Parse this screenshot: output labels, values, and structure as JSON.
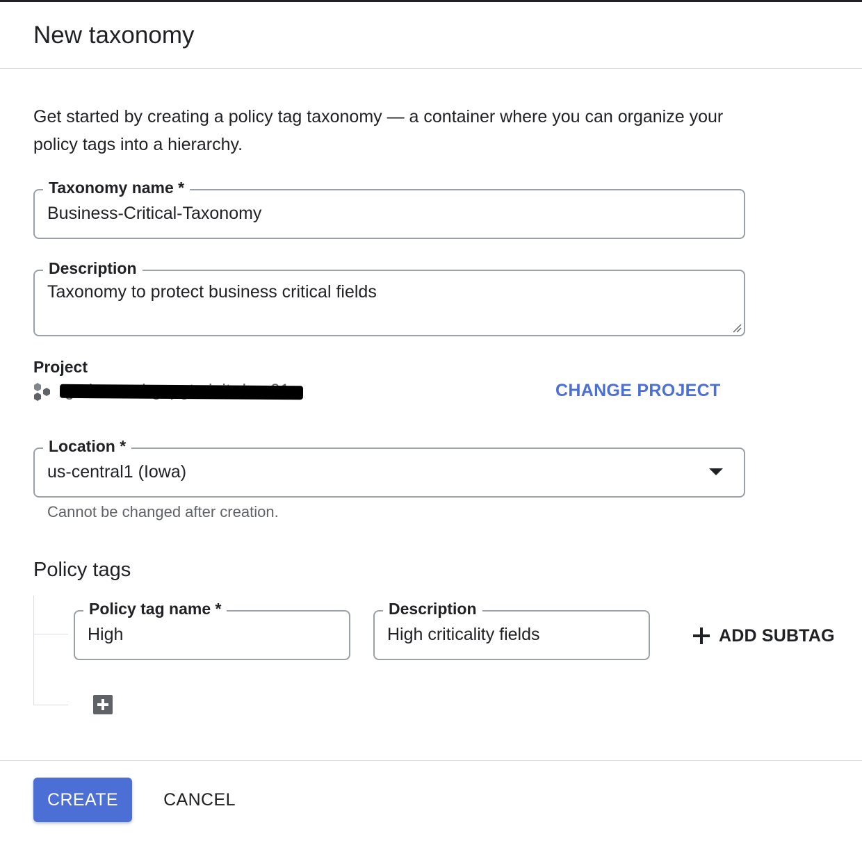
{
  "dialog": {
    "title": "New taxonomy",
    "intro": "Get started by creating a policy tag taxonomy — a container where you can organize your policy tags into a hierarchy."
  },
  "taxonomy_name": {
    "label": "Taxonomy name *",
    "value": "Business-Critical-Taxonomy"
  },
  "description": {
    "label": "Description",
    "value": "Taxonomy to protect business critical fields"
  },
  "project": {
    "label": "Project",
    "name": "tgs-internal-gcpgtminit-dev-01",
    "icon": "project-hexagons-icon",
    "change_label": "CHANGE PROJECT"
  },
  "location": {
    "label": "Location *",
    "value": "us-central1 (Iowa)",
    "hint": "Cannot be changed after creation."
  },
  "policy_tags": {
    "title": "Policy tags",
    "items": [
      {
        "name_label": "Policy tag name *",
        "name_value": "High",
        "description_label": "Description",
        "description_value": "High criticality fields",
        "add_subtag_label": "ADD SUBTAG"
      }
    ]
  },
  "footer": {
    "create_label": "CREATE",
    "cancel_label": "CANCEL"
  },
  "colors": {
    "accent": "#4c6fd6",
    "text": "#202124",
    "muted": "#5f6368",
    "border": "#9aa0a6"
  }
}
